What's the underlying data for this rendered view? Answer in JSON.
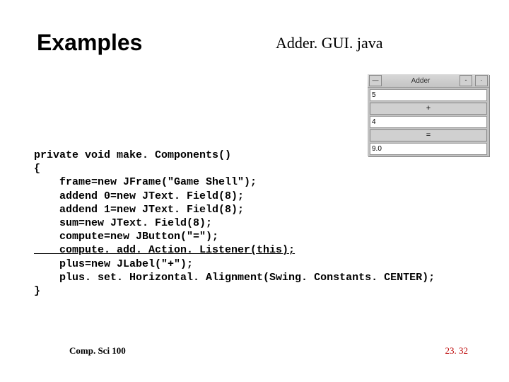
{
  "title": "Examples",
  "filename": "Adder. GUI. java",
  "app": {
    "window_title": "Adder",
    "sysicon": "—",
    "min": "-",
    "close": "·",
    "addend0": "5",
    "plus": "+",
    "addend1": "4",
    "equals": "=",
    "sum": "9.0"
  },
  "code": {
    "l1": "private void make. Components()",
    "l2": "{",
    "l3": "    frame=new JFrame(\"Game Shell\");",
    "l4": "    addend 0=new JText. Field(8);",
    "l5": "    addend 1=new JText. Field(8);",
    "l6": "    sum=new JText. Field(8);",
    "l7": "    compute=new JButton(\"=\");",
    "l8": "    compute. add. Action. Listener(this);",
    "l9": "    plus=new JLabel(\"+\");",
    "l10": "    plus. set. Horizontal. Alignment(Swing. Constants. CENTER);",
    "l11": "}"
  },
  "footer": {
    "left": "Comp. Sci 100",
    "right": "23. 32"
  }
}
